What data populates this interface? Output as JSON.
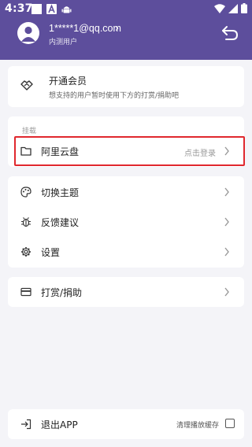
{
  "status_bar": {
    "time": "4:37"
  },
  "account": {
    "name": "1*****1@qq.com",
    "chevron": "›",
    "role": "内测用户"
  },
  "vip": {
    "title": "开通会员",
    "desc": "想支持的用户暂时使用下方的打赏/捐助吧"
  },
  "mount": {
    "section_label": "挂载",
    "drive_label": "阿里云盘",
    "drive_hint": "点击登录"
  },
  "menu": {
    "theme": "切换主题",
    "feedback": "反馈建议",
    "settings": "设置"
  },
  "donate": {
    "label": "打赏/捐助"
  },
  "logout": {
    "label": "退出APP",
    "clear_cache": "清理播放缓存"
  },
  "colors": {
    "header": "#5d4e9c",
    "highlight": "#e0282e"
  },
  "icons": [
    "user-avatar-icon",
    "back-icon",
    "handshake-icon",
    "folder-icon",
    "palette-icon",
    "bug-icon",
    "gear-icon",
    "card-icon",
    "logout-icon",
    "wifi-icon",
    "signal-icon",
    "battery-icon"
  ]
}
